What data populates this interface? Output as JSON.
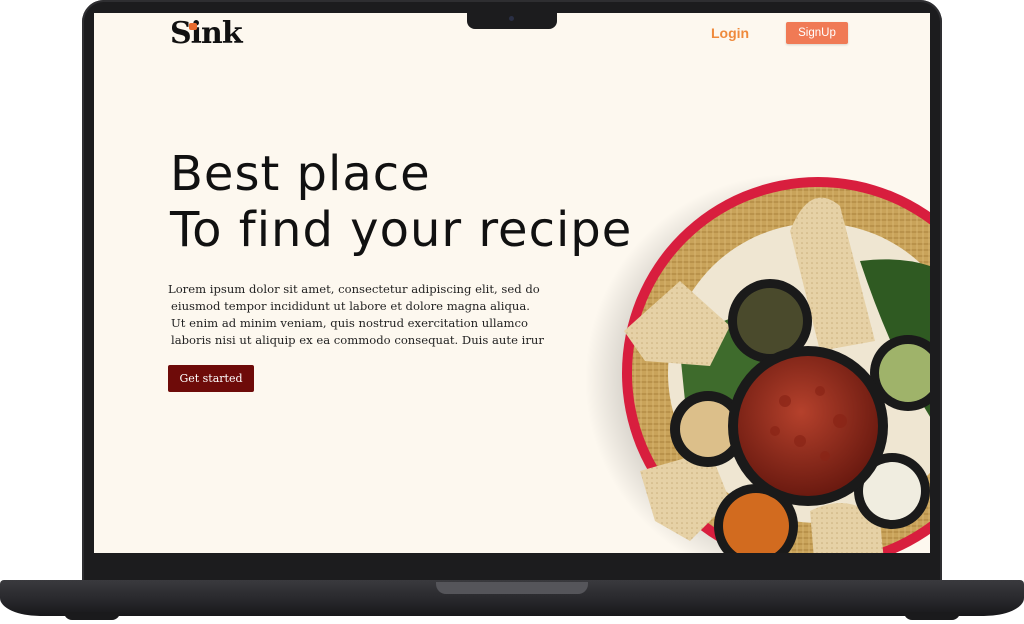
{
  "brand": {
    "name": "Sink"
  },
  "nav": {
    "login": "Login",
    "signup": "SignUp"
  },
  "hero": {
    "title_line1": "Best place",
    "title_line2": "To find your recipe",
    "paragraph_lines": [
      "Lorem ipsum dolor sit amet, consectetur adipiscing elit, sed do",
      "eiusmod tempor incididunt ut labore et dolore magna aliqua.",
      "Ut enim ad minim veniam, quis nostrud exercitation ullamco",
      "laboris nisi ut aliquip ex ea commodo consequat. Duis aute irur"
    ],
    "cta": "Get started"
  },
  "colors": {
    "background": "#fdf8ef",
    "brand_accent": "#e86a2c",
    "login_text": "#ef8a3c",
    "signup_button": "#f07a55",
    "cta_button": "#6e0b09",
    "device_frame": "#1c1c1e"
  },
  "icons": {
    "logo_mark": "orange-square-icon",
    "camera": "camera-notch-icon"
  }
}
